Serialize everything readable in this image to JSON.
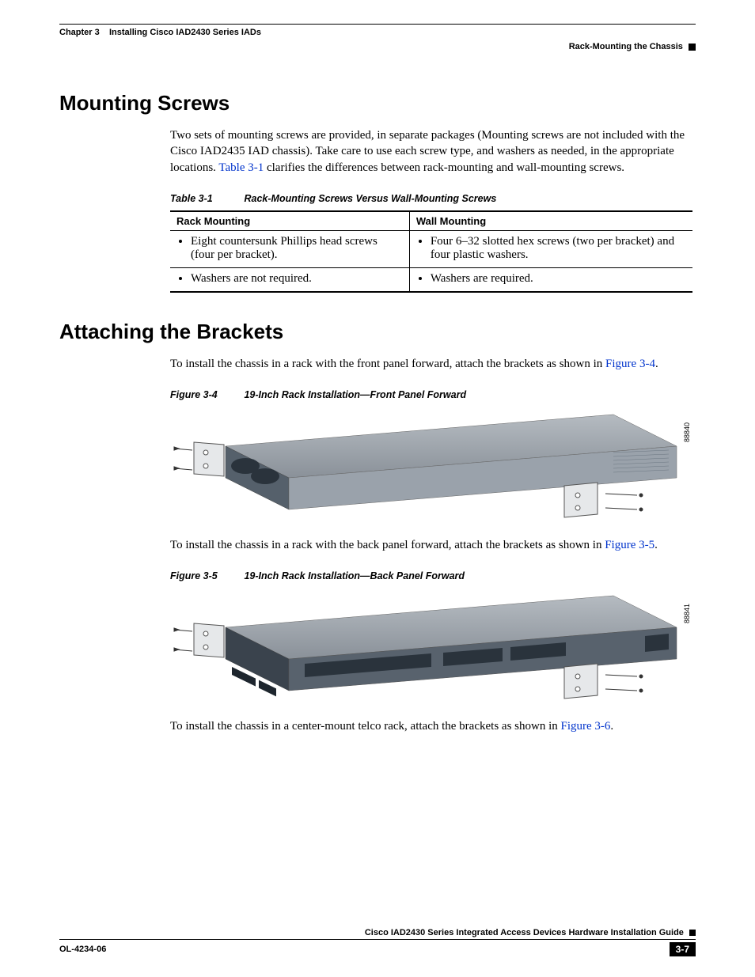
{
  "header": {
    "chapter": "Chapter 3",
    "chapter_title": "Installing Cisco IAD2430 Series IADs",
    "section": "Rack-Mounting the Chassis"
  },
  "section1": {
    "heading": "Mounting Screws",
    "para_a": "Two sets of mounting screws are provided, in separate packages (Mounting screws are not included with the Cisco IAD2435 IAD chassis). Take care to use each screw type, and washers as needed, in the appropriate locations. ",
    "xref1": "Table 3-1",
    "para_b": " clarifies the differences between rack-mounting and wall-mounting screws."
  },
  "table": {
    "number": "Table 3-1",
    "title": "Rack-Mounting Screws Versus Wall-Mounting Screws",
    "col1": "Rack Mounting",
    "col2": "Wall Mounting",
    "r1c1": "Eight countersunk Phillips head screws (four per bracket).",
    "r1c2": "Four 6–32 slotted hex screws (two per bracket) and four plastic washers.",
    "r2c1": "Washers are not required.",
    "r2c2": "Washers are required."
  },
  "section2": {
    "heading": "Attaching the Brackets",
    "para1_a": "To install the chassis in a rack with the front panel forward, attach the brackets as shown in ",
    "para1_xref": "Figure 3-4",
    "para1_b": ".",
    "fig1_num": "Figure 3-4",
    "fig1_title": "19-Inch Rack Installation—Front Panel Forward",
    "fig1_id": "88840",
    "para2_a": "To install the chassis in a rack with the back panel forward, attach the brackets as shown in ",
    "para2_xref": "Figure 3-5",
    "para2_b": ".",
    "fig2_num": "Figure 3-5",
    "fig2_title": "19-Inch Rack Installation—Back Panel Forward",
    "fig2_id": "88841",
    "para3_a": "To install the chassis in a center-mount telco rack, attach the brackets as shown in ",
    "para3_xref": "Figure 3-6",
    "para3_b": "."
  },
  "footer": {
    "guide": "Cisco IAD2430 Series Integrated Access Devices Hardware Installation Guide",
    "docnum": "OL-4234-06",
    "pagenum": "3-7"
  }
}
